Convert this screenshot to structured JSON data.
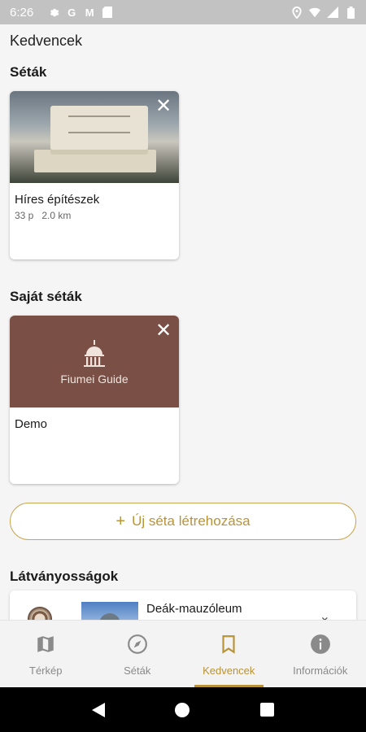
{
  "status_bar": {
    "time": "6:26",
    "left_icons": [
      "gear-icon",
      "google-icon",
      "gmail-icon",
      "sd-card-icon"
    ],
    "right_icons": [
      "location-icon",
      "wifi-icon",
      "signal-icon",
      "battery-icon"
    ],
    "google_glyph": "G",
    "gmail_glyph": "M"
  },
  "page": {
    "title": "Kedvencek"
  },
  "sections": {
    "walks": "Séták",
    "own_walks": "Saját séták",
    "sights": "Látványosságok"
  },
  "walk_cards": [
    {
      "title": "Híres építészek",
      "duration": "33 p",
      "distance": "2.0 km",
      "close": "✕"
    }
  ],
  "own_walk_cards": [
    {
      "title": "Demo",
      "logo_text": "Fiumei Guide",
      "close": "✕"
    }
  ],
  "new_walk_button": {
    "plus": "+",
    "label": "Új séta létrehozása"
  },
  "sight_items": [
    {
      "name": "Deák-mauzóleum",
      "chevron": "⌄"
    }
  ],
  "bottom_nav": {
    "items": [
      {
        "label": "Térkép",
        "icon": "map-icon",
        "active": false
      },
      {
        "label": "Séták",
        "icon": "compass-icon",
        "active": false
      },
      {
        "label": "Kedvencek",
        "icon": "bookmark-icon",
        "active": true
      },
      {
        "label": "Információk",
        "icon": "info-icon",
        "active": false
      }
    ]
  },
  "colors": {
    "accent": "#b89338",
    "brand_brown": "#7a4f45",
    "status_bar": "#c2c2c2",
    "background": "#f5f5f5"
  }
}
